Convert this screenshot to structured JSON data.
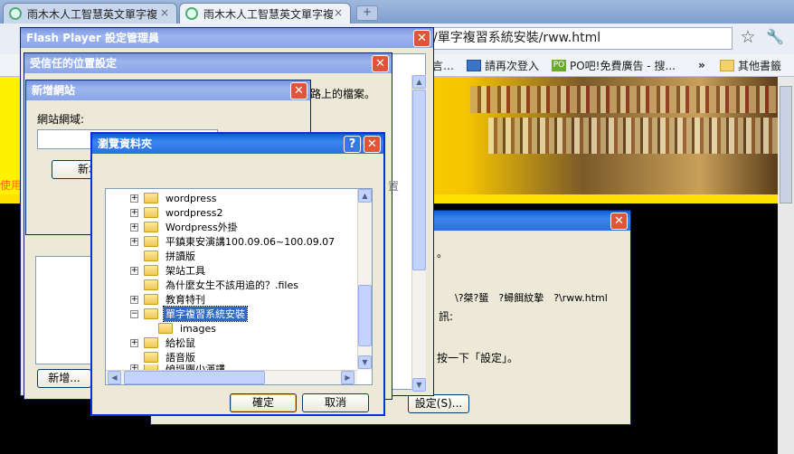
{
  "browser": {
    "tabs": [
      {
        "title": "雨木木人工智慧英文單字複"
      },
      {
        "title": "雨木木人工智慧英文單字複"
      }
    ],
    "new_tab_symbol": "+",
    "close_symbol": "×",
    "address": "/單字複習系統安裝/rww.html",
    "bookmarks": [
      {
        "label": "言…"
      },
      {
        "label": "請再次登入"
      },
      {
        "label": "PO吧!免費廣告 - 搜..."
      },
      {
        "label": "»"
      },
      {
        "label": "其他書籤"
      }
    ],
    "po_icon_text": "PO"
  },
  "page": {
    "left_link": "使用"
  },
  "flash_manager": {
    "title": "Flash Player 設定管理員"
  },
  "trusted_dialog": {
    "title": "受信任的位置設定",
    "text_fragment": "路上的檔案。",
    "text_fragment2": "置"
  },
  "add_site": {
    "title": "新增網站",
    "label": "網站網域:",
    "input_value": "",
    "button_partial": "新增"
  },
  "back_dialog": {
    "line1": "。",
    "path": "\\?桀?蜑　?蟳餌紋摯　?\\rww.html",
    "line2": "訊:",
    "line3": "按一下「設定」。",
    "settings_button": "設定(S)..."
  },
  "left_panel": {
    "add_button": "新增..."
  },
  "browse_folder": {
    "title": "瀏覽資料夾",
    "help": "?",
    "tree": [
      {
        "label": "wordpress",
        "expander": "+",
        "level": 0
      },
      {
        "label": "wordpress2",
        "expander": "+",
        "level": 0
      },
      {
        "label": "Wordpress外掛",
        "expander": "+",
        "level": 0
      },
      {
        "label": "平鎮東安演講100.09.06~100.09.07",
        "expander": "+",
        "level": 0
      },
      {
        "label": "拼讀版",
        "expander": "",
        "level": 0
      },
      {
        "label": "架站工具",
        "expander": "+",
        "level": 0
      },
      {
        "label": "為什麼女生不該用追的？.files",
        "expander": "",
        "level": 0
      },
      {
        "label": "教育特刊",
        "expander": "+",
        "level": 0
      },
      {
        "label": "單字複習系統安裝",
        "expander": "−",
        "level": 0,
        "selected": true
      },
      {
        "label": "images",
        "expander": "",
        "level": 1
      },
      {
        "label": "給松鼠",
        "expander": "+",
        "level": 0
      },
      {
        "label": "語音版",
        "expander": "",
        "level": 0
      },
      {
        "label": "碩班團小演講",
        "expander": "+",
        "level": 0
      }
    ],
    "ok_button": "確定",
    "cancel_button": "取消"
  }
}
